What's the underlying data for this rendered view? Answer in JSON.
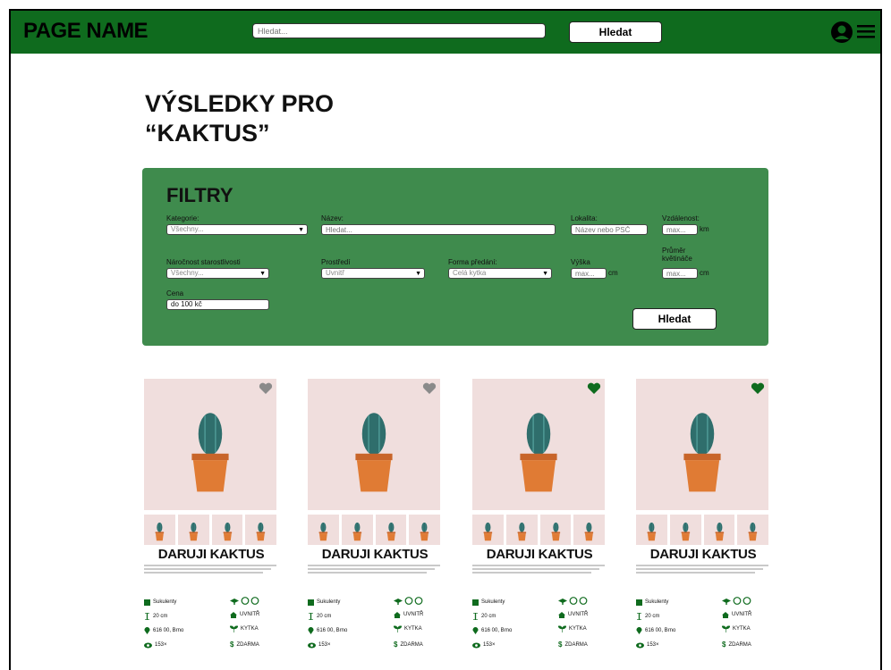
{
  "header": {
    "brand": "PAGE NAME",
    "search_placeholder": "Hledat...",
    "search_button": "Hledat",
    "user_icon": "user-circle-icon",
    "menu_icon": "hamburger-menu-icon",
    "accent_color": "#0f6b1e"
  },
  "page": {
    "title_line1": "VÝSLEDKY PRO",
    "title_line2": "“KAKTUS”"
  },
  "filters": {
    "title": "FILTRY",
    "panel_color": "#3f8b4d",
    "kategorie_label": "Kategorie:",
    "kategorie_value": "Všechny...",
    "nazev_label": "Název:",
    "nazev_placeholder": "Hledat...",
    "lokalita_label": "Lokalita:",
    "lokalita_placeholder": "Název nebo PSČ",
    "vzdalenost_label": "Vzdálenost:",
    "vzdalenost_placeholder": "max...",
    "vzdalenost_unit": "km",
    "narocnost_label": "Náročnost starostlivosti",
    "narocnost_value": "Všechny...",
    "prostredi_label": "Prostředí",
    "prostredi_value": "Uvnitř",
    "forma_label": "Forma předání:",
    "forma_value": "Celá kytka",
    "vyska_label": "Výška",
    "vyska_placeholder": "max...",
    "vyska_unit": "cm",
    "prumer_label_1": "Průměr",
    "prumer_label_2": "květináče",
    "prumer_placeholder": "max...",
    "prumer_unit": "cm",
    "cena_label": "Cena",
    "cena_value": "do 100 kč",
    "search_button": "Hledat"
  },
  "cards": [
    {
      "title": "DARUJI KAKTUS",
      "category": "Sukulenty",
      "size": "20 cm",
      "location": "616 00, Brno",
      "views": "153×",
      "care": "3/3",
      "environment": "UVNITŘ",
      "form": "KYTKA",
      "price": "ZDARMA",
      "favorite": false
    },
    {
      "title": "DARUJI KAKTUS",
      "category": "Sukulenty",
      "size": "20 cm",
      "location": "616 00, Brno",
      "views": "153×",
      "care": "3/3",
      "environment": "UVNITŘ",
      "form": "KYTKA",
      "price": "ZDARMA",
      "favorite": false
    },
    {
      "title": "DARUJI KAKTUS",
      "category": "Sukulenty",
      "size": "20 cm",
      "location": "616 00, Brno",
      "views": "153×",
      "care": "3/3",
      "environment": "UVNITŘ",
      "form": "KYTKA",
      "price": "ZDARMA",
      "favorite": true
    },
    {
      "title": "DARUJI KAKTUS",
      "category": "Sukulenty",
      "size": "20 cm",
      "location": "616 00, Brno",
      "views": "153×",
      "care": "3/3",
      "environment": "UVNITŘ",
      "form": "KYTKA",
      "price": "ZDARMA",
      "favorite": true
    }
  ],
  "colors": {
    "heart_inactive": "#8a8a8a",
    "heart_active": "#0f6b1e",
    "icon_green": "#0f6b1e",
    "image_bg": "#f0dedd",
    "pot": "#e07b34",
    "cactus": "#2f6e6c"
  }
}
